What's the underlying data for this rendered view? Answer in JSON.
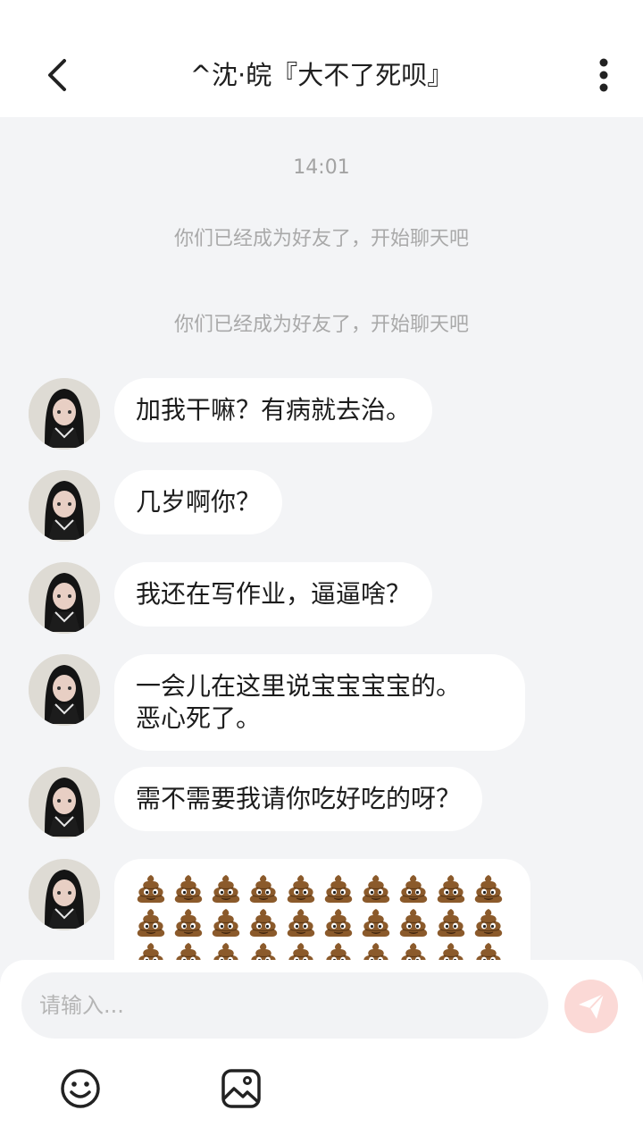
{
  "header": {
    "title": "^沈·皖『大不了死呗』"
  },
  "chat": {
    "timestamp": "14:01",
    "system_messages": [
      "你们已经成为好友了，开始聊天吧",
      "你们已经成为好友了，开始聊天吧"
    ],
    "messages": [
      {
        "text": "加我干嘛？有病就去治。"
      },
      {
        "text": "几岁啊你？"
      },
      {
        "text": "我还在写作业，逼逼啥？"
      },
      {
        "lines": [
          "一会儿在这里说宝宝宝宝的。",
          "恶心死了。"
        ]
      },
      {
        "text": "需不需要我请你吃好吃的呀？"
      },
      {
        "emoji": "pile-of-poo",
        "visible_count": 30
      }
    ]
  },
  "composer": {
    "placeholder": "请输入...",
    "send_icon": "paper-plane-icon",
    "tools": [
      "smiley-icon",
      "image-icon"
    ]
  },
  "colors": {
    "background": "#f3f4f6",
    "bubble": "#ffffff",
    "send_button": "#fbd9d6",
    "send_icon": "#ffffff"
  }
}
